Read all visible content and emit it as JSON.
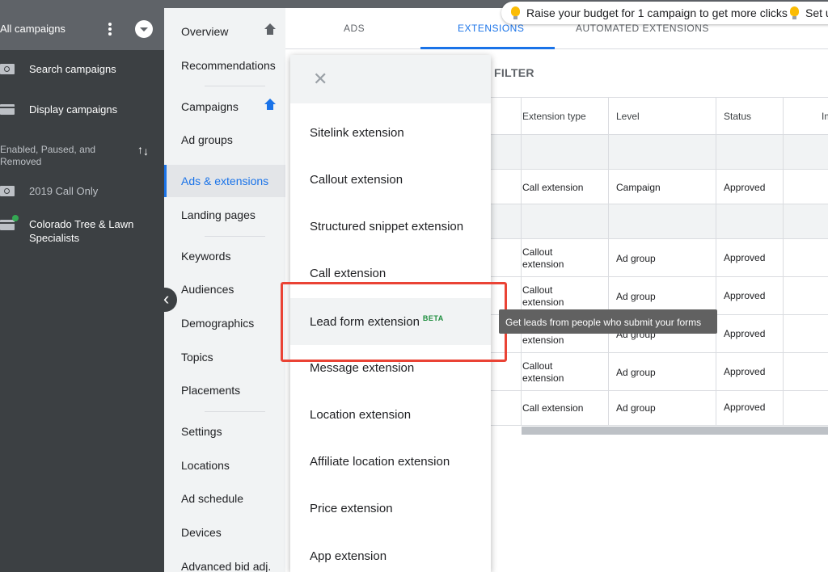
{
  "left_sidebar": {
    "all_campaigns_label": "All campaigns",
    "items": [
      {
        "label": "Search campaigns",
        "icon": "search-icon"
      },
      {
        "label": "Display campaigns",
        "icon": "display-icon"
      }
    ],
    "filter_label": "Enabled, Paused, and Removed",
    "campaigns": [
      {
        "label": "2019 Call Only",
        "icon": "search-icon"
      },
      {
        "label": "Colorado Tree & Lawn Specialists",
        "icon": "display-icon",
        "status_color": "#34a853"
      }
    ]
  },
  "nav": {
    "items": [
      {
        "label": "Overview"
      },
      {
        "label": "Recommendations"
      },
      {
        "label": "Campaigns"
      },
      {
        "label": "Ad groups"
      },
      {
        "label": "Ads & extensions"
      },
      {
        "label": "Landing pages"
      },
      {
        "label": "Keywords"
      },
      {
        "label": "Audiences"
      },
      {
        "label": "Demographics"
      },
      {
        "label": "Topics"
      },
      {
        "label": "Placements"
      },
      {
        "label": "Settings"
      },
      {
        "label": "Locations"
      },
      {
        "label": "Ad schedule"
      },
      {
        "label": "Devices"
      },
      {
        "label": "Advanced bid adj."
      }
    ]
  },
  "tabs": [
    {
      "label": "ADS"
    },
    {
      "label": "EXTENSIONS"
    },
    {
      "label": "AUTOMATED EXTENSIONS"
    }
  ],
  "notices": [
    {
      "text": "Raise your budget for 1 campaign to get more clicks"
    },
    {
      "text": "Set u"
    }
  ],
  "filter_text": "FILTER",
  "table": {
    "headers": [
      "Extension type",
      "Level",
      "Status",
      "Im"
    ],
    "rows": [
      {
        "type": "Call extension",
        "level": "Campaign",
        "status": "Approved"
      },
      {
        "type": "Callout extension",
        "level": "Ad group",
        "status": "Approved"
      },
      {
        "type": "Callout extension",
        "level": "Ad group",
        "status": "Approved"
      },
      {
        "type": "extension",
        "level": "Ad group",
        "status": "Approved"
      },
      {
        "type": "Callout extension",
        "level": "Ad group",
        "status": "Approved"
      },
      {
        "type": "Call extension",
        "level": "Ad group",
        "status": "Approved"
      }
    ]
  },
  "menu": {
    "items": [
      {
        "label": "Sitelink extension"
      },
      {
        "label": "Callout extension"
      },
      {
        "label": "Structured snippet extension"
      },
      {
        "label": "Call extension"
      },
      {
        "label": "Lead form extension",
        "badge": "BETA"
      },
      {
        "label": "Message extension"
      },
      {
        "label": "Location extension"
      },
      {
        "label": "Affiliate location extension"
      },
      {
        "label": "Price extension"
      },
      {
        "label": "App extension"
      }
    ]
  },
  "tooltip": "Get leads from people who submit your forms",
  "colors": {
    "accent": "#1a73e8",
    "highlight": "#ea4335",
    "beta": "#1e8e3e"
  }
}
